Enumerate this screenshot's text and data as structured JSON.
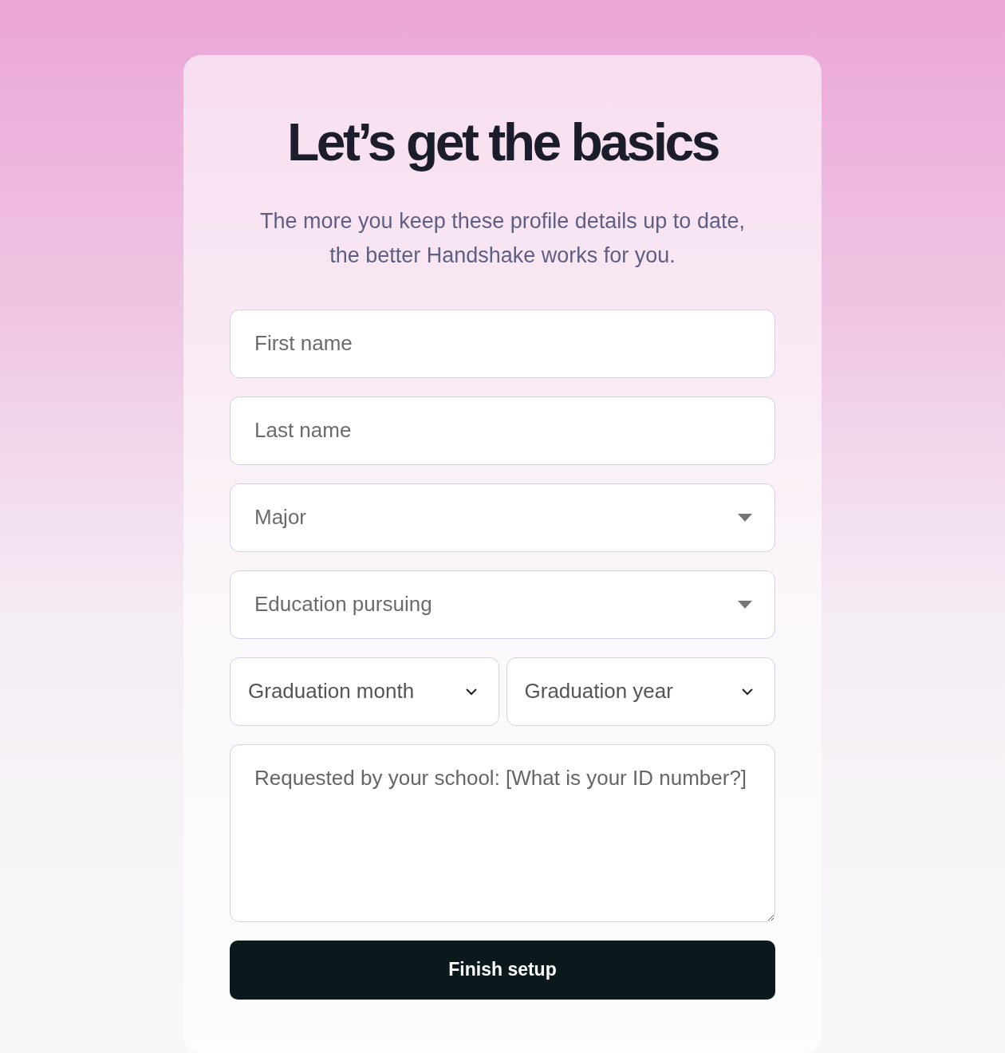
{
  "heading": "Let’s get the basics",
  "subtitle": "The more you keep these profile details up to date, the better Handshake works for you.",
  "fields": [
    {
      "kind": "text",
      "placeholder": "First name"
    },
    {
      "kind": "text",
      "placeholder": "Last name"
    },
    {
      "kind": "dropdown",
      "placeholder": "Major"
    },
    {
      "kind": "dropdown",
      "placeholder": "Education pursuing"
    },
    {
      "kind": "pair",
      "items": [
        {
          "placeholder": "Graduation month"
        },
        {
          "placeholder": "Graduation year"
        }
      ]
    },
    {
      "kind": "textarea",
      "placeholder": "Requested by your school: [What is your ID number?]"
    }
  ],
  "button": {
    "label": "Finish setup"
  }
}
